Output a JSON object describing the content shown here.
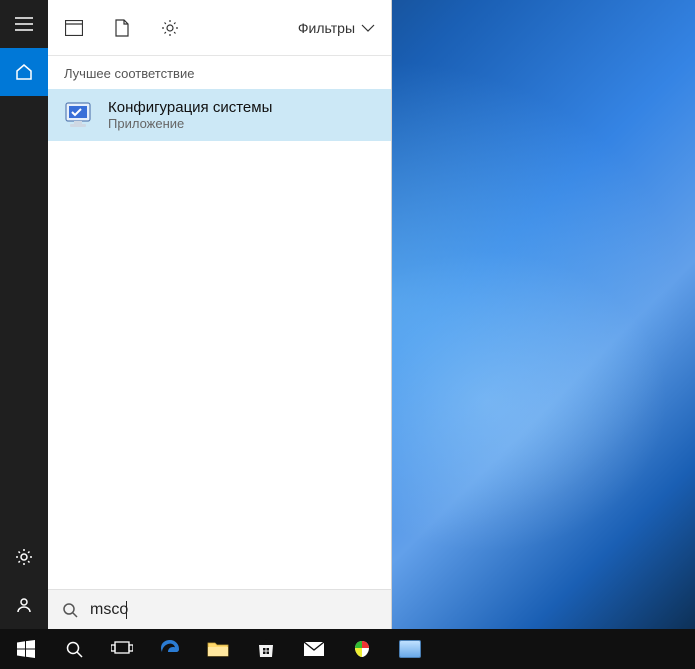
{
  "colors": {
    "accent": "#0078d7",
    "result_highlight": "#cce8f6",
    "rail_bg": "#1f1f1f",
    "taskbar_bg": "#101010"
  },
  "rail": {
    "menu": "menu",
    "home": "home",
    "settings": "settings",
    "user": "user"
  },
  "topbar": {
    "apps_icon": "apps",
    "documents_icon": "document",
    "settings_icon": "gear",
    "filters_label": "Фильтры"
  },
  "results": {
    "section_header": "Лучшее соответствие",
    "items": [
      {
        "title": "Конфигурация системы",
        "subtitle": "Приложение",
        "icon": "msconfig"
      }
    ]
  },
  "search": {
    "value": "msco",
    "placeholder": ""
  },
  "taskbar": {
    "items": [
      "start",
      "search",
      "task-view",
      "edge",
      "file-explorer",
      "store",
      "mail",
      "app1",
      "app2"
    ]
  }
}
